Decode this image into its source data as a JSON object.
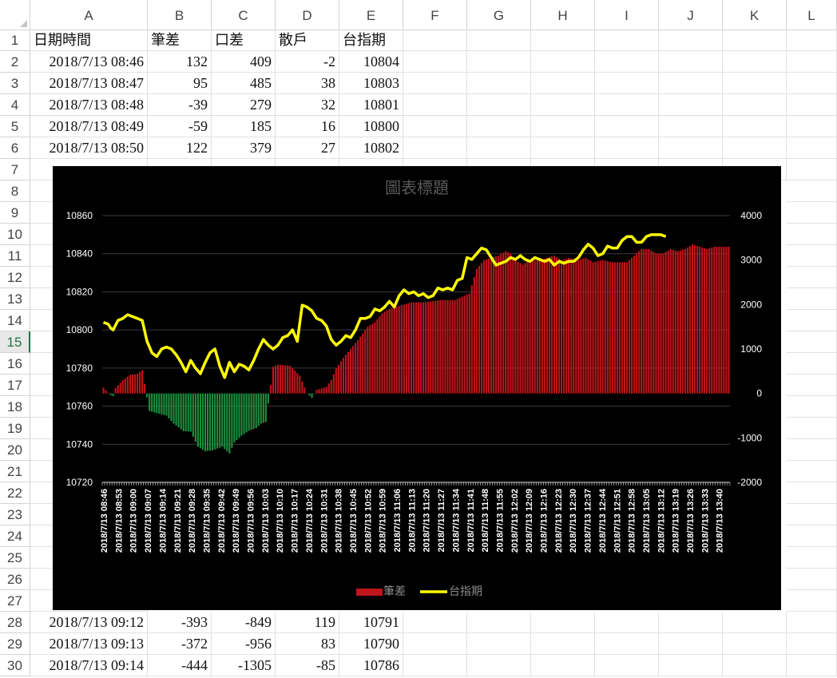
{
  "columns": [
    "A",
    "B",
    "C",
    "D",
    "E",
    "F",
    "G",
    "H",
    "I",
    "J",
    "K",
    "L"
  ],
  "rows": [
    "1",
    "2",
    "3",
    "4",
    "5",
    "6",
    "7",
    "8",
    "9",
    "10",
    "11",
    "12",
    "13",
    "14",
    "15",
    "16",
    "17",
    "18",
    "19",
    "20",
    "21",
    "22",
    "23",
    "24",
    "25",
    "26",
    "27",
    "28",
    "29",
    "30"
  ],
  "active_row": "15",
  "header_row": [
    "日期時間",
    "筆差",
    "口差",
    "散戶",
    "台指期"
  ],
  "data_rows_top": [
    [
      "2018/7/13 08:46",
      "132",
      "409",
      "-2",
      "10804"
    ],
    [
      "2018/7/13 08:47",
      "95",
      "485",
      "38",
      "10803"
    ],
    [
      "2018/7/13 08:48",
      "-39",
      "279",
      "32",
      "10801"
    ],
    [
      "2018/7/13 08:49",
      "-59",
      "185",
      "16",
      "10800"
    ],
    [
      "2018/7/13 08:50",
      "122",
      "379",
      "27",
      "10802"
    ]
  ],
  "data_rows_bottom": [
    [
      "2018/7/13 09:12",
      "-393",
      "-849",
      "119",
      "10791"
    ],
    [
      "2018/7/13 09:13",
      "-372",
      "-956",
      "83",
      "10790"
    ],
    [
      "2018/7/13 09:14",
      "-444",
      "-1305",
      "-85",
      "10786"
    ]
  ],
  "colors": {
    "bar_pos": "#c0141b",
    "bar_neg": "#1e8f3e",
    "line": "#ffff00",
    "chart_bg": "#000000"
  },
  "chart_data": {
    "type": "bar+line",
    "title": "圖表標題",
    "left_axis": {
      "min": 10720,
      "max": 10860,
      "step": 20,
      "ticks": [
        "10860",
        "10840",
        "10820",
        "10800",
        "10780",
        "10760",
        "10740",
        "10720"
      ]
    },
    "right_axis": {
      "min": -2000,
      "max": 4000,
      "step": 1000,
      "ticks": [
        "4000",
        "3000",
        "2000",
        "1000",
        "0",
        "-1000",
        "-2000"
      ]
    },
    "x_tick_labels": [
      "2018/7/13 08:46",
      "2018/7/13 08:53",
      "2018/7/13 09:00",
      "2018/7/13 09:07",
      "2018/7/13 09:14",
      "2018/7/13 09:21",
      "2018/7/13 09:28",
      "2018/7/13 09:35",
      "2018/7/13 09:42",
      "2018/7/13 09:49",
      "2018/7/13 09:56",
      "2018/7/13 10:03",
      "2018/7/13 10:10",
      "2018/7/13 10:17",
      "2018/7/13 10:24",
      "2018/7/13 10:31",
      "2018/7/13 10:38",
      "2018/7/13 10:45",
      "2018/7/13 10:52",
      "2018/7/13 10:59",
      "2018/7/13 11:06",
      "2018/7/13 11:13",
      "2018/7/13 11:20",
      "2018/7/13 11:27",
      "2018/7/13 11:34",
      "2018/7/13 11:41",
      "2018/7/13 11:48",
      "2018/7/13 11:55",
      "2018/7/13 12:02",
      "2018/7/13 12:09",
      "2018/7/13 12:16",
      "2018/7/13 12:23",
      "2018/7/13 12:30",
      "2018/7/13 12:37",
      "2018/7/13 12:44",
      "2018/7/13 12:51",
      "2018/7/13 12:58",
      "2018/7/13 13:05",
      "2018/7/13 13:12",
      "2018/7/13 13:19",
      "2018/7/13 13:26",
      "2018/7/13 13:33",
      "2018/7/13 13:40"
    ],
    "legend_placement": "bottom",
    "series": [
      {
        "name": "筆差",
        "kind": "bar",
        "axis": "right",
        "knots": [
          [
            0,
            132
          ],
          [
            3,
            -39
          ],
          [
            4,
            -59
          ],
          [
            5,
            122
          ],
          [
            8,
            300
          ],
          [
            11,
            420
          ],
          [
            14,
            440
          ],
          [
            16,
            520
          ],
          [
            19,
            -393
          ],
          [
            22,
            -444
          ],
          [
            26,
            -500
          ],
          [
            29,
            -680
          ],
          [
            33,
            -850
          ],
          [
            36,
            -860
          ],
          [
            39,
            -1200
          ],
          [
            42,
            -1300
          ],
          [
            45,
            -1280
          ],
          [
            49,
            -1200
          ],
          [
            52,
            -1350
          ],
          [
            54,
            -1100
          ],
          [
            57,
            -950
          ],
          [
            60,
            -840
          ],
          [
            63,
            -780
          ],
          [
            65,
            -680
          ],
          [
            67,
            -640
          ],
          [
            70,
            600
          ],
          [
            72,
            650
          ],
          [
            77,
            620
          ],
          [
            81,
            400
          ],
          [
            84,
            0
          ],
          [
            86,
            -100
          ],
          [
            88,
            80
          ],
          [
            92,
            150
          ],
          [
            94,
            300
          ],
          [
            96,
            560
          ],
          [
            99,
            800
          ],
          [
            102,
            1000
          ],
          [
            105,
            1200
          ],
          [
            109,
            1500
          ],
          [
            112,
            1600
          ],
          [
            115,
            1800
          ],
          [
            118,
            1900
          ],
          [
            121,
            1950
          ],
          [
            124,
            2000
          ],
          [
            127,
            2050
          ],
          [
            130,
            2050
          ],
          [
            133,
            2050
          ],
          [
            136,
            2080
          ],
          [
            139,
            2100
          ],
          [
            141,
            2100
          ],
          [
            143,
            2100
          ],
          [
            145,
            2100
          ],
          [
            147,
            2150
          ],
          [
            149,
            2200
          ],
          [
            151,
            2250
          ],
          [
            154,
            2800
          ],
          [
            157,
            3000
          ],
          [
            160,
            3050
          ],
          [
            163,
            3100
          ],
          [
            166,
            3200
          ],
          [
            168,
            3150
          ],
          [
            170,
            3000
          ],
          [
            173,
            2900
          ],
          [
            176,
            3000
          ],
          [
            180,
            3000
          ],
          [
            183,
            3050
          ],
          [
            186,
            3100
          ],
          [
            189,
            3000
          ],
          [
            192,
            3050
          ],
          [
            196,
            3000
          ],
          [
            199,
            3050
          ],
          [
            202,
            2950
          ],
          [
            206,
            3000
          ],
          [
            210,
            2950
          ],
          [
            213,
            2950
          ],
          [
            216,
            2950
          ],
          [
            219,
            3100
          ],
          [
            222,
            3250
          ],
          [
            225,
            3250
          ],
          [
            228,
            3150
          ],
          [
            231,
            3150
          ],
          [
            234,
            3250
          ],
          [
            237,
            3200
          ],
          [
            240,
            3250
          ],
          [
            243,
            3350
          ],
          [
            246,
            3300
          ],
          [
            249,
            3250
          ],
          [
            252,
            3300
          ],
          [
            255,
            3300
          ],
          [
            258,
            3300
          ]
        ]
      },
      {
        "name": "台指期",
        "kind": "line",
        "axis": "left",
        "knots": [
          [
            0,
            10804
          ],
          [
            2,
            10803
          ],
          [
            3,
            10801
          ],
          [
            4,
            10800
          ],
          [
            6,
            10805
          ],
          [
            8,
            10806
          ],
          [
            10,
            10808
          ],
          [
            12,
            10807
          ],
          [
            14,
            10806
          ],
          [
            16,
            10805
          ],
          [
            18,
            10794
          ],
          [
            20,
            10788
          ],
          [
            22,
            10786
          ],
          [
            24,
            10790
          ],
          [
            26,
            10791
          ],
          [
            28,
            10790
          ],
          [
            30,
            10787
          ],
          [
            32,
            10783
          ],
          [
            34,
            10778
          ],
          [
            36,
            10784
          ],
          [
            38,
            10780
          ],
          [
            40,
            10777
          ],
          [
            42,
            10783
          ],
          [
            44,
            10788
          ],
          [
            46,
            10790
          ],
          [
            48,
            10781
          ],
          [
            50,
            10775
          ],
          [
            52,
            10783
          ],
          [
            54,
            10778
          ],
          [
            56,
            10782
          ],
          [
            58,
            10781
          ],
          [
            60,
            10779
          ],
          [
            62,
            10784
          ],
          [
            64,
            10790
          ],
          [
            66,
            10795
          ],
          [
            68,
            10792
          ],
          [
            70,
            10790
          ],
          [
            72,
            10792
          ],
          [
            74,
            10796
          ],
          [
            76,
            10797
          ],
          [
            78,
            10800
          ],
          [
            80,
            10794
          ],
          [
            82,
            10813
          ],
          [
            84,
            10812
          ],
          [
            86,
            10810
          ],
          [
            88,
            10806
          ],
          [
            90,
            10805
          ],
          [
            92,
            10802
          ],
          [
            94,
            10795
          ],
          [
            96,
            10792
          ],
          [
            98,
            10794
          ],
          [
            100,
            10797
          ],
          [
            102,
            10796
          ],
          [
            104,
            10800
          ],
          [
            106,
            10806
          ],
          [
            108,
            10806
          ],
          [
            110,
            10807
          ],
          [
            112,
            10811
          ],
          [
            114,
            10810
          ],
          [
            116,
            10812
          ],
          [
            118,
            10815
          ],
          [
            120,
            10812
          ],
          [
            122,
            10818
          ],
          [
            124,
            10821
          ],
          [
            126,
            10819
          ],
          [
            128,
            10820
          ],
          [
            130,
            10818
          ],
          [
            132,
            10819
          ],
          [
            134,
            10817
          ],
          [
            136,
            10818
          ],
          [
            138,
            10822
          ],
          [
            140,
            10821
          ],
          [
            142,
            10822
          ],
          [
            144,
            10821
          ],
          [
            146,
            10826
          ],
          [
            148,
            10827
          ],
          [
            150,
            10838
          ],
          [
            152,
            10837
          ],
          [
            154,
            10840
          ],
          [
            156,
            10843
          ],
          [
            158,
            10842
          ],
          [
            160,
            10838
          ],
          [
            162,
            10834
          ],
          [
            164,
            10835
          ],
          [
            166,
            10836
          ],
          [
            168,
            10838
          ],
          [
            170,
            10837
          ],
          [
            172,
            10839
          ],
          [
            174,
            10837
          ],
          [
            176,
            10836
          ],
          [
            178,
            10838
          ],
          [
            180,
            10837
          ],
          [
            182,
            10836
          ],
          [
            184,
            10837
          ],
          [
            186,
            10834
          ],
          [
            188,
            10836
          ],
          [
            190,
            10835
          ],
          [
            192,
            10836
          ],
          [
            194,
            10836
          ],
          [
            196,
            10838
          ],
          [
            198,
            10842
          ],
          [
            200,
            10845
          ],
          [
            202,
            10843
          ],
          [
            204,
            10839
          ],
          [
            206,
            10840
          ],
          [
            208,
            10844
          ],
          [
            210,
            10843
          ],
          [
            212,
            10843
          ],
          [
            214,
            10847
          ],
          [
            216,
            10849
          ],
          [
            218,
            10849
          ],
          [
            220,
            10846
          ],
          [
            222,
            10846
          ],
          [
            224,
            10849
          ],
          [
            226,
            10850
          ],
          [
            228,
            10850
          ],
          [
            230,
            10850
          ],
          [
            232,
            10849
          ]
        ]
      }
    ]
  }
}
